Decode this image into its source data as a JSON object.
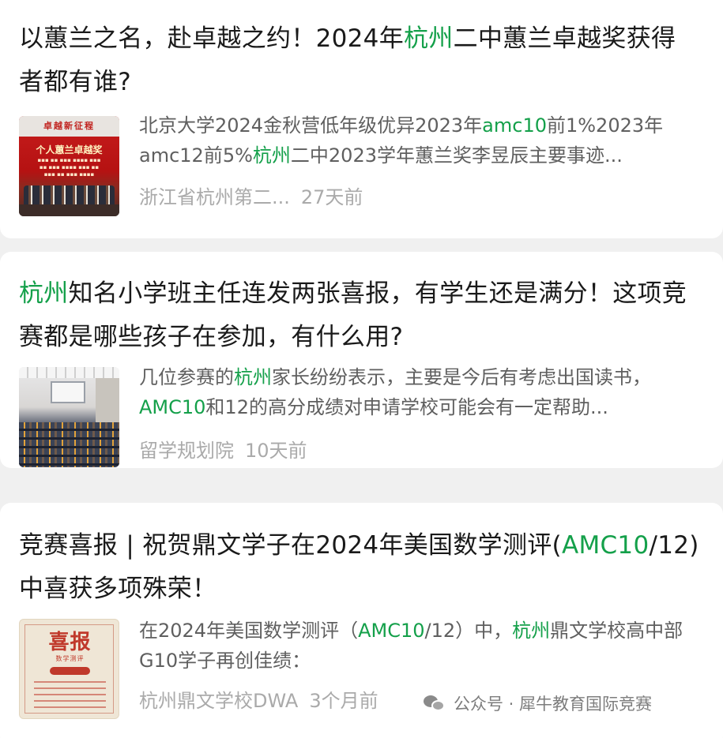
{
  "colors": {
    "highlight": "#14a04a",
    "title_text": "#1a1a1a",
    "snippet_text": "#5f5f5f",
    "meta_text": "#aaaaaa",
    "card_bg": "#ffffff",
    "page_bg": "#f0f0f0"
  },
  "results": [
    {
      "title": [
        {
          "t": "以蕙兰之名，赴卓越之约！2024年",
          "hl": false
        },
        {
          "t": "杭州",
          "hl": true
        },
        {
          "t": "二中蕙兰卓越奖获得者都有谁?",
          "hl": false
        }
      ],
      "snippet": [
        {
          "t": "北京大学2024金秋营低年级优异2023年",
          "hl": false
        },
        {
          "t": "amc10",
          "hl": true
        },
        {
          "t": "前1%2023年amc12前5%",
          "hl": false
        },
        {
          "t": "杭州",
          "hl": true
        },
        {
          "t": "二中2023学年蕙兰奖李昱辰主要事迹...",
          "hl": false
        }
      ],
      "source": "浙江省杭州第二...",
      "time": "27天前",
      "thumb": {
        "type": "award-ceremony-photo",
        "banner": "卓越新征程",
        "heading": "个人蕙兰卓越奖"
      }
    },
    {
      "title": [
        {
          "t": "杭州",
          "hl": true
        },
        {
          "t": "知名小学班主任连发两张喜报，有学生还是满分！这项竞赛都是哪些孩子在参加，有什么用?",
          "hl": false
        }
      ],
      "snippet": [
        {
          "t": "几位参赛的",
          "hl": false
        },
        {
          "t": "杭州",
          "hl": true
        },
        {
          "t": "家长纷纷表示，主要是今后有考虑出国读书，",
          "hl": false
        },
        {
          "t": "AMC10",
          "hl": true
        },
        {
          "t": "和12的高分成绩对申请学校可能会有一定帮助...",
          "hl": false
        }
      ],
      "source": "留学规划院",
      "time": "10天前",
      "thumb": {
        "type": "lecture-hall-photo"
      }
    },
    {
      "title": [
        {
          "t": "竞赛喜报 | 祝贺鼎文学子在2024年美国数学测评(",
          "hl": false
        },
        {
          "t": "AMC10",
          "hl": true
        },
        {
          "t": "/12)中喜获多项殊荣！",
          "hl": false
        }
      ],
      "snippet": [
        {
          "t": "在2024年美国数学测评（",
          "hl": false
        },
        {
          "t": "AMC10",
          "hl": true
        },
        {
          "t": "/12）中，",
          "hl": false
        },
        {
          "t": "杭州",
          "hl": true
        },
        {
          "t": "鼎文学校高中部G10学子再创佳绩：",
          "hl": false
        }
      ],
      "source": "杭州鼎文学校DWA",
      "time": "3个月前",
      "thumb": {
        "type": "poster",
        "heading": "喜报",
        "subheading": "数学测评"
      }
    }
  ],
  "watermark": {
    "icon": "wechat-icon",
    "text": "公众号 · 犀牛教育国际竞赛"
  }
}
